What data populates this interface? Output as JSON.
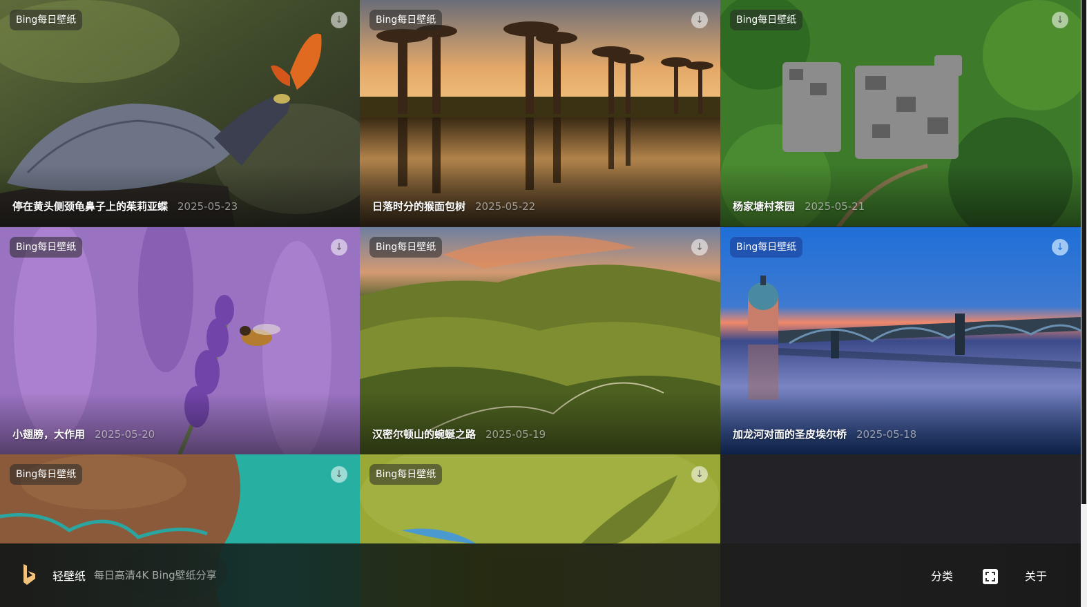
{
  "cards": [
    {
      "badge": "Bing每日壁纸",
      "title": "停在黄头侧颈龟鼻子上的茱莉亚蝶",
      "date": "2025-05-23"
    },
    {
      "badge": "Bing每日壁纸",
      "title": "日落时分的猴面包树",
      "date": "2025-05-22"
    },
    {
      "badge": "Bing每日壁纸",
      "title": "杨家塘村茶园",
      "date": "2025-05-21"
    },
    {
      "badge": "Bing每日壁纸",
      "title": "小翅膀，大作用",
      "date": "2025-05-20"
    },
    {
      "badge": "Bing每日壁纸",
      "title": "汉密尔顿山的蜿蜒之路",
      "date": "2025-05-19"
    },
    {
      "badge": "Bing每日壁纸",
      "title": "加龙河对面的圣皮埃尔桥",
      "date": "2025-05-18"
    },
    {
      "badge": "Bing每日壁纸"
    },
    {
      "badge": "Bing每日壁纸"
    }
  ],
  "footer": {
    "app_name": "轻壁纸",
    "app_subtitle": "每日高清4K Bing壁纸分享",
    "nav_category": "分类",
    "nav_about": "关于"
  },
  "icons": {
    "download": "download-icon",
    "fullscreen": "fullscreen-icon",
    "logo": "bing-logo-icon"
  }
}
